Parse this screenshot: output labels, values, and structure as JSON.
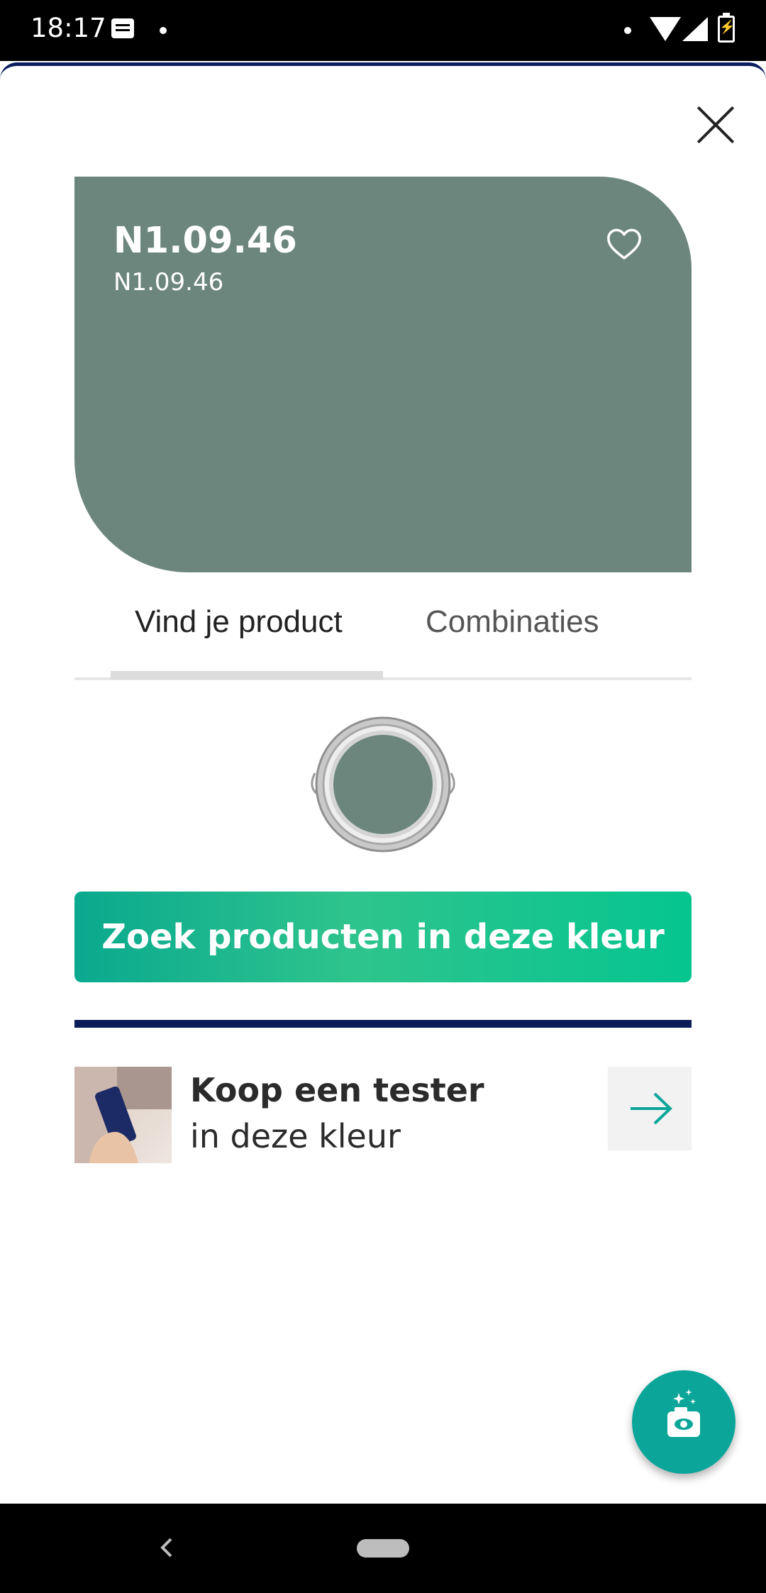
{
  "status_bar": {
    "time": "18:17",
    "icons": [
      "message-icon",
      "dot-icon",
      "wifi-icon",
      "signal-icon",
      "battery-charging-icon"
    ]
  },
  "color_card": {
    "code": "N1.09.46",
    "subcode": "N1.09.46",
    "swatch_color": "#6c867d"
  },
  "tabs": [
    {
      "label": "Vind je product",
      "active": true
    },
    {
      "label": "Combinaties",
      "active": false
    }
  ],
  "cta": {
    "label": "Zoek producten in deze kleur"
  },
  "tester": {
    "title": "Koop een tester",
    "subtitle": "in deze kleur"
  },
  "colors": {
    "accent": "#0ba59a",
    "cta_gradient": [
      "#0aa98e",
      "#05c58f"
    ],
    "divider": "#0b1c56"
  }
}
